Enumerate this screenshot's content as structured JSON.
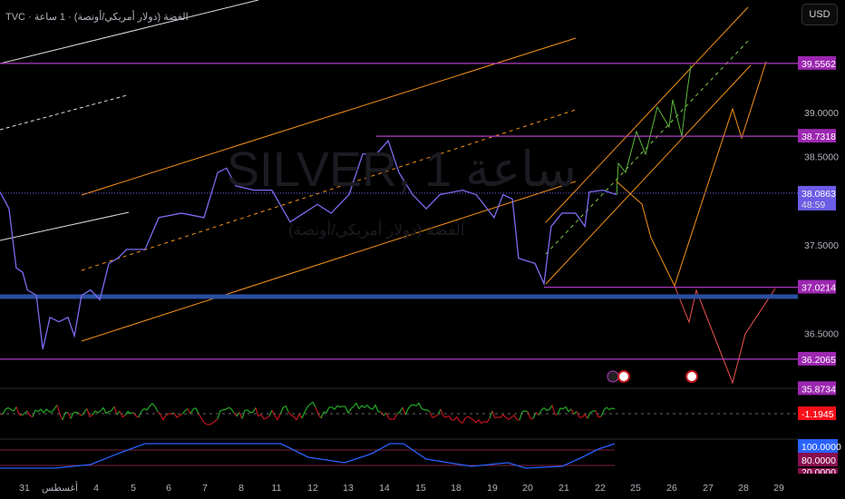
{
  "header": {
    "title": "TVC · الفضة (دولار أمريكي/أونصة) · 1 ساعة",
    "currency": "USD"
  },
  "watermark": {
    "symbol": "SILVER, 1 ساعة",
    "description": "الفضة (دولار أمريكي/أونصة)"
  },
  "colors": {
    "price_line": "#7b6cf0",
    "channel": "#f7931a",
    "level": "#b13cc4",
    "support_band": "#2a4fa0",
    "last_price": "#6c5ce7",
    "osc_up": "#22ab25",
    "osc_down": "#c0161d",
    "osc_label": "#f7101a",
    "stoch": "#2962ff"
  },
  "chart_data": {
    "type": "line",
    "title": "SILVER, 1H",
    "xlabel": "",
    "ylabel": "USD",
    "ylim": [
      35.75,
      40.3
    ],
    "x_tick_labels": [
      "31",
      "أغسطس",
      "4",
      "5",
      "6",
      "7",
      "8",
      "11",
      "12",
      "13",
      "14",
      "15",
      "18",
      "19",
      "20",
      "21",
      "22",
      "25",
      "26",
      "27",
      "28",
      "29"
    ],
    "y_tick_labels": [
      "39.0000",
      "38.5000",
      "37.5000",
      "36.5000"
    ],
    "y_ticks": [
      39.0,
      38.5,
      37.5,
      36.5
    ],
    "level_labels": [
      "39.5562",
      "38.7318",
      "37.0214",
      "36.2065",
      "35.8734"
    ],
    "levels": [
      39.5562,
      38.7318,
      37.0214,
      36.2065,
      35.8734
    ],
    "support_band": 36.91,
    "last_price": {
      "value": "38.0863",
      "countdown": "48:59",
      "price": 38.0863
    },
    "series": [
      {
        "name": "SILVER",
        "x": [
          -0.68,
          -0.43,
          -0.23,
          -0.05,
          0.08,
          0.33,
          0.51,
          0.71,
          0.96,
          1.21,
          1.39,
          1.59,
          1.84,
          2.1,
          2.35,
          2.6,
          2.85,
          3.36,
          3.74,
          4.37,
          5.0,
          5.38,
          5.63,
          5.88,
          6.39,
          6.89,
          7.4,
          7.78,
          8.16,
          8.54,
          9.04,
          9.42,
          9.8,
          10.13,
          10.43,
          10.81,
          11.19,
          11.57,
          12.2,
          12.58,
          13.08,
          13.33,
          13.59,
          13.76,
          14.22,
          14.47,
          14.67,
          14.97,
          15.35,
          15.61,
          15.73,
          16.11,
          16.49
        ],
        "values": [
          38.1,
          37.91,
          37.24,
          37.19,
          36.99,
          36.93,
          36.32,
          36.68,
          36.63,
          36.68,
          36.47,
          36.93,
          36.99,
          36.88,
          37.29,
          37.35,
          37.45,
          37.45,
          37.81,
          37.86,
          37.81,
          38.32,
          38.37,
          38.17,
          38.12,
          38.12,
          37.76,
          37.86,
          37.96,
          37.86,
          38.07,
          38.53,
          38.53,
          38.68,
          38.32,
          38.07,
          37.91,
          38.07,
          38.12,
          38.07,
          37.81,
          38.07,
          38.02,
          37.35,
          37.29,
          37.06,
          37.71,
          37.86,
          37.86,
          37.71,
          38.1,
          38.12,
          38.07
        ]
      }
    ],
    "oscillator": {
      "value_label": "-1.1945"
    },
    "stochastic": {
      "labels": [
        "100.0000",
        "80.0000",
        "20.0000"
      ]
    }
  }
}
